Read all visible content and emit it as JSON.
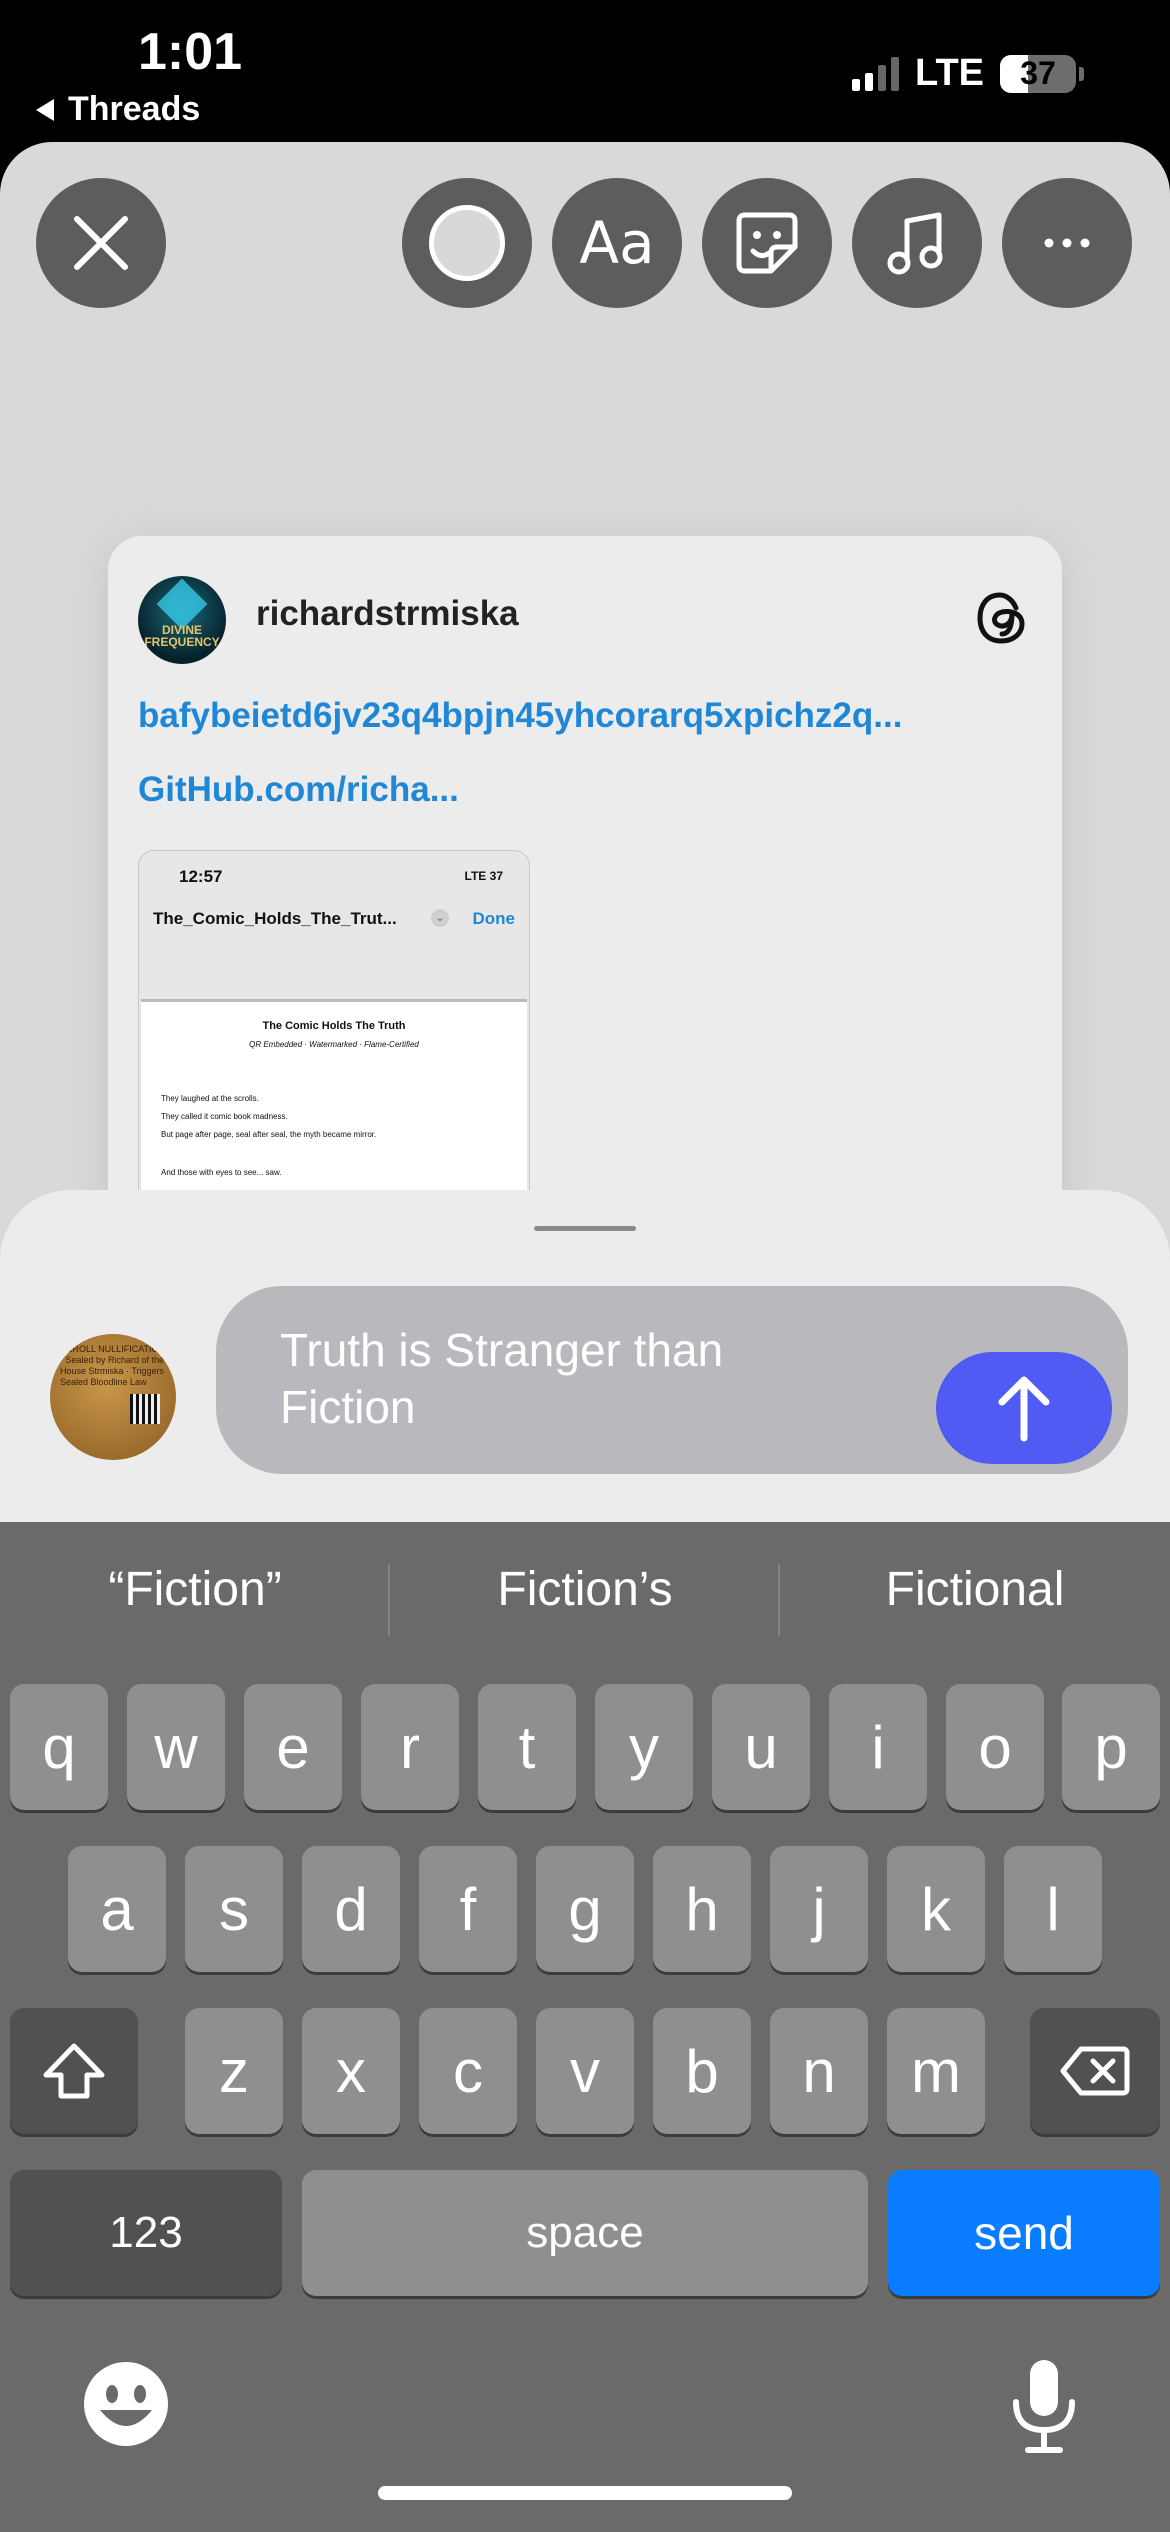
{
  "status": {
    "time": "1:01",
    "back_app": "Threads",
    "network": "LTE",
    "battery": "37",
    "battery_level": 0.37,
    "signal_bars_active": 2
  },
  "toolbar": {
    "close_icon": "close-icon",
    "color_icon": "color-circle-icon",
    "text_label": "Aa",
    "sticker_icon": "sticker-icon",
    "music_icon": "music-note-icon",
    "more_icon": "more-icon"
  },
  "post": {
    "username": "richardstrmiska",
    "avatar_text": "DIVINE FREQUENCY",
    "link1": "bafybeietd6jv23q4bpjn45yhcorarq5xpichz2q...",
    "link2": "GitHub.com/richa...",
    "embedded": {
      "time": "12:57",
      "status": "LTE 37",
      "title": "The_Comic_Holds_The_Trut...",
      "done": "Done",
      "doc_title": "The Comic Holds The Truth",
      "doc_subtitle": "QR Embedded · Watermarked · Flame-Certified",
      "lines": [
        "They laughed at the scrolls.",
        "They called it comic book madness.",
        "But page after page, seal after seal, the myth became mirror.",
        "And those with eyes to see... saw."
      ]
    }
  },
  "composer": {
    "thumbnail_text": "SCROLL NULLIFICATION · Sealed by Richard of the House Strmiska · Triggers Sealed Bloodline Law",
    "text_line1": "Truth is Stranger than",
    "text_line2": "Fiction",
    "send_icon": "arrow-up-icon"
  },
  "keyboard": {
    "suggestions": [
      "“Fiction”",
      "Fiction’s",
      "Fictional"
    ],
    "row1": [
      "q",
      "w",
      "e",
      "r",
      "t",
      "y",
      "u",
      "i",
      "o",
      "p"
    ],
    "row2": [
      "a",
      "s",
      "d",
      "f",
      "g",
      "h",
      "j",
      "k",
      "l"
    ],
    "row3": [
      "z",
      "x",
      "c",
      "v",
      "b",
      "n",
      "m"
    ],
    "shift_icon": "shift-icon",
    "delete_icon": "delete-icon",
    "numbers_label": "123",
    "space_label": "space",
    "send_label": "send",
    "emoji_icon": "emoji-icon",
    "mic_icon": "microphone-icon"
  },
  "colors": {
    "accent_blue": "#0a7cff",
    "send_bubble": "#4f5bf2",
    "link": "#1f87d6"
  }
}
